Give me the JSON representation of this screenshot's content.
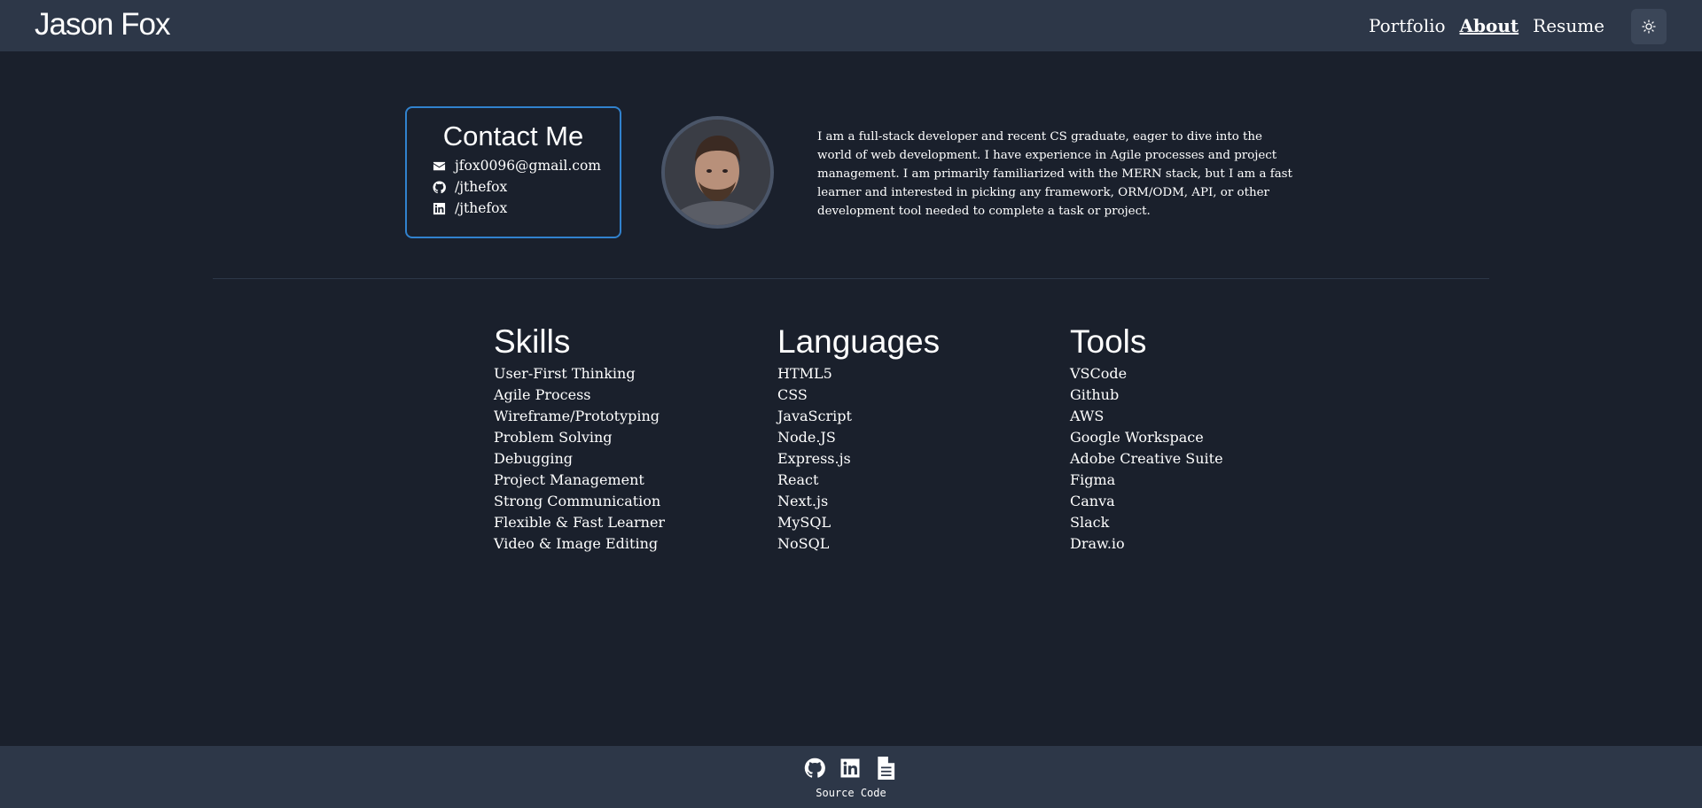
{
  "header": {
    "brand": "Jason Fox",
    "nav": [
      {
        "label": "Portfolio",
        "active": false
      },
      {
        "label": "About",
        "active": true
      },
      {
        "label": "Resume",
        "active": false
      }
    ],
    "theme_toggle_icon": "sun-icon"
  },
  "contact": {
    "title": "Contact Me",
    "email": "jfox0096@gmail.com",
    "github": "/jthefox",
    "linkedin": "/jthefox"
  },
  "bio": "I am a full-stack developer and recent CS graduate, eager to dive into the world of web development. I have experience in Agile processes and project management. I am primarily familiarized with the MERN stack, but I am a fast learner and interested in picking any framework, ORM/ODM, API, or other development tool needed to complete a task or project.",
  "skills": {
    "title": "Skills",
    "items": [
      "User-First Thinking",
      "Agile Process",
      "Wireframe/Prototyping",
      "Problem Solving",
      "Debugging",
      "Project Management",
      "Strong Communication",
      "Flexible & Fast Learner",
      "Video & Image Editing"
    ]
  },
  "languages": {
    "title": "Languages",
    "items": [
      "HTML5",
      "CSS",
      "JavaScript",
      "Node.JS",
      "Express.js",
      "React",
      "Next.js",
      "MySQL",
      "NoSQL"
    ]
  },
  "tools": {
    "title": "Tools",
    "items": [
      "VSCode",
      "Github",
      "AWS",
      "Google Workspace",
      "Adobe Creative Suite",
      "Figma",
      "Canva",
      "Slack",
      "Draw.io"
    ]
  },
  "footer": {
    "icons": [
      "github-icon",
      "linkedin-icon",
      "document-icon"
    ],
    "source_label": "Source Code"
  },
  "colors": {
    "background": "#1a202c",
    "header": "#2d3748",
    "accent_border": "#3182ce"
  }
}
